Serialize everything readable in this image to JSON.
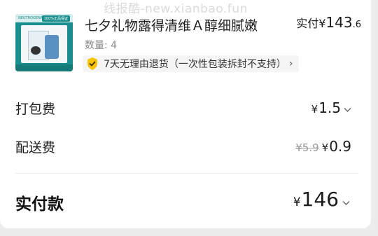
{
  "watermark": "线报酷-new.xianbao.fun",
  "product": {
    "title": "七夕礼物露得清维Ａ醇细腻嫩",
    "quantity_label": "数量: 4",
    "price_prefix": "实付¥",
    "price_int": "143",
    "price_dec": ".6",
    "thumb_logo": "NEUTROGENA",
    "thumb_tag": "100%正品保证"
  },
  "guarantee": {
    "text": "7天无理由退货（一次性包装拆封不支持）",
    "chevron": "›"
  },
  "fees": [
    {
      "label": "打包费",
      "currency": "¥",
      "value": "1.5",
      "original": ""
    },
    {
      "label": "配送费",
      "currency": "¥",
      "value": "0.9",
      "original": "¥5.9"
    }
  ],
  "total": {
    "label": "实付款",
    "currency": "¥",
    "value": "146"
  },
  "colors": {
    "shield_yellow": "#f7c400",
    "brand_teal": "#1b8f8f"
  },
  "icons": {
    "shield": "shield-check-icon",
    "chevron_down": "chevron-down-icon",
    "chevron_right": "chevron-right-icon"
  }
}
